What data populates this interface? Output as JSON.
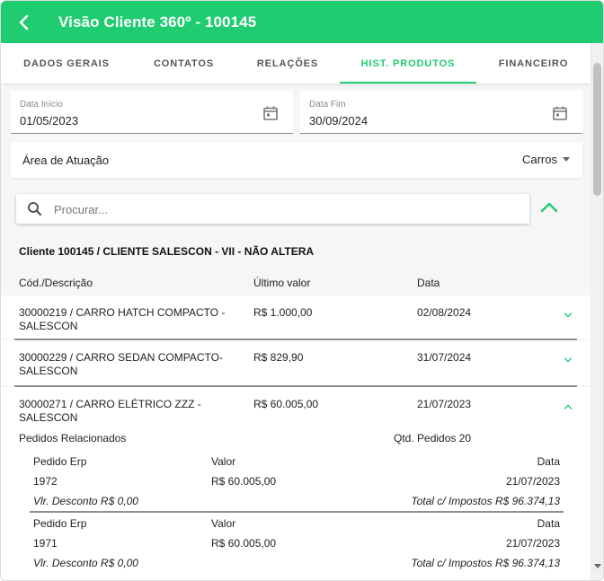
{
  "colors": {
    "accent": "#1fcc6f",
    "header_text": "#ffffff",
    "divider": "#8f8f8f"
  },
  "header": {
    "title": "Visão Cliente 360º - 100145",
    "back_icon": "back-arrow-icon"
  },
  "tabs": [
    {
      "label": "DADOS GERAIS",
      "active": false
    },
    {
      "label": "CONTATOS",
      "active": false
    },
    {
      "label": "RELAÇÕES",
      "active": false
    },
    {
      "label": "HIST. PRODUTOS",
      "active": true
    },
    {
      "label": "FINANCEIRO",
      "active": false
    }
  ],
  "filters": {
    "start": {
      "label": "Data Início",
      "value": "01/05/2023",
      "icon": "calendar-icon"
    },
    "end": {
      "label": "Data Fim",
      "value": "30/09/2024",
      "icon": "calendar-icon"
    },
    "area": {
      "label": "Área de Atuação",
      "value": "Carros"
    }
  },
  "search": {
    "placeholder": "Procurar...",
    "icon": "search-icon"
  },
  "client": {
    "title": "Cliente 100145 / CLIENTE SALESCON - VII - NÃO ALTERA"
  },
  "columns": {
    "desc": "Cód./Descrição",
    "value": "Último valor",
    "date": "Data"
  },
  "products": [
    {
      "desc": "30000219 / CARRO HATCH COMPACTO - SALESCON",
      "value": "R$ 1.000,00",
      "date": "02/08/2024",
      "expanded": false
    },
    {
      "desc": "30000229 / CARRO SEDAN COMPACTO- SALESCON",
      "value": "R$ 829,90",
      "date": "31/07/2024",
      "expanded": false
    },
    {
      "desc": "30000271 / CARRO ELÉTRICO ZZZ - SALESCON",
      "value": "R$ 60.005,00",
      "date": "21/07/2023",
      "expanded": true
    }
  ],
  "related": {
    "label": "Pedidos Relacionados",
    "qty": "Qtd. Pedidos 20",
    "headers": {
      "order": "Pedido Erp",
      "value": "Valor",
      "date": "Data"
    },
    "orders": [
      {
        "order": "1972",
        "value": "R$ 60.005,00",
        "date": "21/07/2023",
        "discount": "Vlr. Desconto R$ 0,00",
        "total": "Total c/ Impostos R$ 96.374,13"
      },
      {
        "order": "1971",
        "value": "R$ 60.005,00",
        "date": "21/07/2023",
        "discount": "Vlr. Desconto R$ 0,00",
        "total": "Total c/ Impostos R$ 96.374,13"
      }
    ]
  }
}
